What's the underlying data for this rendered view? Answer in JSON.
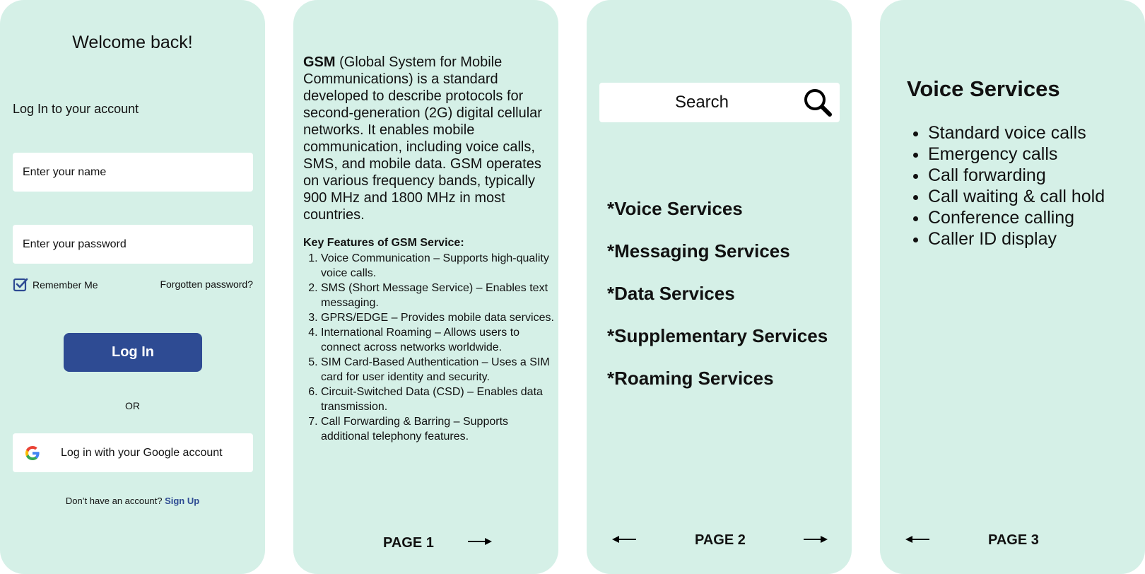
{
  "login": {
    "welcome": "Welcome back!",
    "subtitle": "Log In to your account",
    "name_placeholder": "Enter your name",
    "password_placeholder": "Enter your password",
    "remember_label": "Remember Me",
    "remember_checked": true,
    "forgot_label": "Forgotten password?",
    "login_button": "Log In",
    "or_text": "OR",
    "google_button": "Log in with your Google account",
    "signup_prompt": "Don’t have an account?",
    "signup_link": "Sign Up"
  },
  "page1": {
    "intro_bold": "GSM",
    "intro_text": " (Global System for Mobile Communications) is a standard developed to describe protocols for second-generation (2G) digital cellular networks. It enables mobile communication, including voice calls, SMS, and mobile data. GSM operates on various frequency bands, typically 900 MHz and 1800 MHz in most countries.",
    "features_title": "Key Features of GSM Service:",
    "features": [
      "Voice Communication – Supports high-quality voice calls.",
      "SMS (Short Message Service) – Enables text messaging.",
      "GPRS/EDGE – Provides mobile data services.",
      "International Roaming – Allows users to connect across networks worldwide.",
      "SIM Card-Based Authentication – Uses a SIM card for user identity and security.",
      "Circuit-Switched Data (CSD) – Enables data transmission.",
      "Call Forwarding & Barring – Supports additional telephony features."
    ],
    "page_label": "PAGE 1"
  },
  "page2": {
    "search_placeholder": "Search",
    "services": [
      "*Voice Services",
      "*Messaging Services",
      "*Data Services",
      "*Supplementary Services",
      "*Roaming Services"
    ],
    "page_label": "PAGE 2"
  },
  "page3": {
    "title": "Voice Services",
    "items": [
      "Standard voice calls",
      "Emergency calls",
      "Call forwarding",
      "Call waiting & call hold",
      "Conference calling",
      "Caller ID display"
    ],
    "page_label": "PAGE 3"
  },
  "colors": {
    "panel_bg": "#d5f0e7",
    "primary": "#2e4b93",
    "text": "#111111",
    "field_bg": "#ffffff"
  }
}
